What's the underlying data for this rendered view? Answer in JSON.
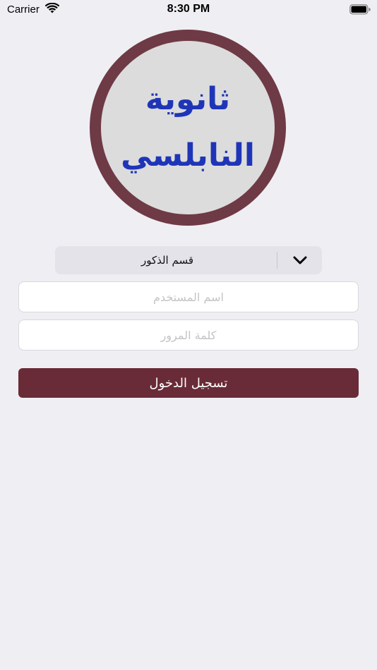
{
  "status_bar": {
    "carrier": "Carrier",
    "time": "8:30 PM",
    "wifi_icon": "wifi-icon",
    "battery_icon": "battery-icon"
  },
  "logo": {
    "line1": "ثانوية",
    "line2": "النابلسي",
    "text_color": "#1f35b8",
    "ring_color": "#6e3a45",
    "fill_color": "#dcdcdc"
  },
  "department_select": {
    "selected": "قسم الذكور",
    "icon": "chevron-down-icon"
  },
  "username": {
    "value": "",
    "placeholder": "اسم المستخدم"
  },
  "password": {
    "value": "",
    "placeholder": "كلمة المرور"
  },
  "login_button": {
    "label": "تسجيل الدخول",
    "color": "#692b37"
  }
}
